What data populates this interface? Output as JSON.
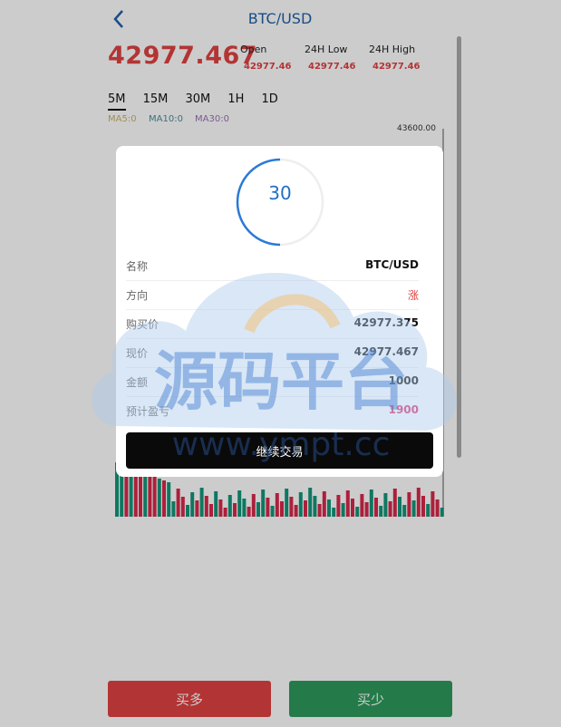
{
  "header": {
    "title": "BTC/USD"
  },
  "price": "42977.467",
  "stats": [
    {
      "label": "Open",
      "value": "42977.46"
    },
    {
      "label": "24H Low",
      "value": "42977.46"
    },
    {
      "label": "24H High",
      "value": "42977.46"
    }
  ],
  "tabs": [
    "5M",
    "15M",
    "30M",
    "1H",
    "1D"
  ],
  "ma": {
    "ma5": "MA5:0",
    "ma10": "MA10:0",
    "ma30": "MA30:0"
  },
  "chart": {
    "top_label": "43600.00",
    "up_color": "#12967a",
    "down_color": "#d8284a"
  },
  "modal": {
    "countdown": "30",
    "rows": [
      {
        "key": "名称",
        "value": "BTC/USD"
      },
      {
        "key": "方向",
        "value": "涨"
      },
      {
        "key": "购买价",
        "value": "42977.375"
      },
      {
        "key": "现价",
        "value": "42977.467"
      },
      {
        "key": "金额",
        "value": "1000"
      },
      {
        "key": "预计盈亏",
        "value": "1900"
      }
    ],
    "continue_label": "继续交易"
  },
  "buttons": {
    "buy_long": "买多",
    "buy_short": "买少",
    "long_color": "#e04242",
    "short_color": "#2e9a5c"
  },
  "watermark": {
    "cn": "源码平台",
    "url": "www.ympt.cc"
  }
}
